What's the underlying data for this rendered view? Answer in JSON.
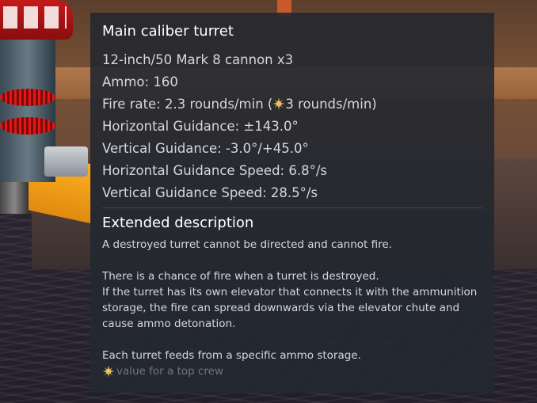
{
  "tooltip": {
    "title": "Main caliber turret",
    "stats": [
      "12-inch/50 Mark 8 cannon x3",
      "Ammo: 160"
    ],
    "fire_rate_prefix": "Fire rate: 2.3 rounds/min (",
    "fire_rate_ace": "3 rounds/min)",
    "stats_after": [
      "Horizontal Guidance: ±143.0°",
      "Vertical Guidance: -3.0°/+45.0°",
      "Horizontal Guidance Speed: 6.8°/s",
      "Vertical Guidance Speed: 28.5°/s"
    ],
    "extended_title": "Extended description",
    "paragraphs": [
      "A destroyed turret cannot be directed and cannot fire.",
      "There is a chance of fire when a turret is destroyed.\nIf the turret has its own elevator that connects it with the ammunition\nstorage, the fire can spread downwards via the elevator chute and\ncause ammo detonation.",
      "Each turret feeds from a specific ammo storage."
    ],
    "footnote": "value for a top crew",
    "ace_icon": "ace-crew-icon",
    "ace_color": "#e8c060"
  }
}
